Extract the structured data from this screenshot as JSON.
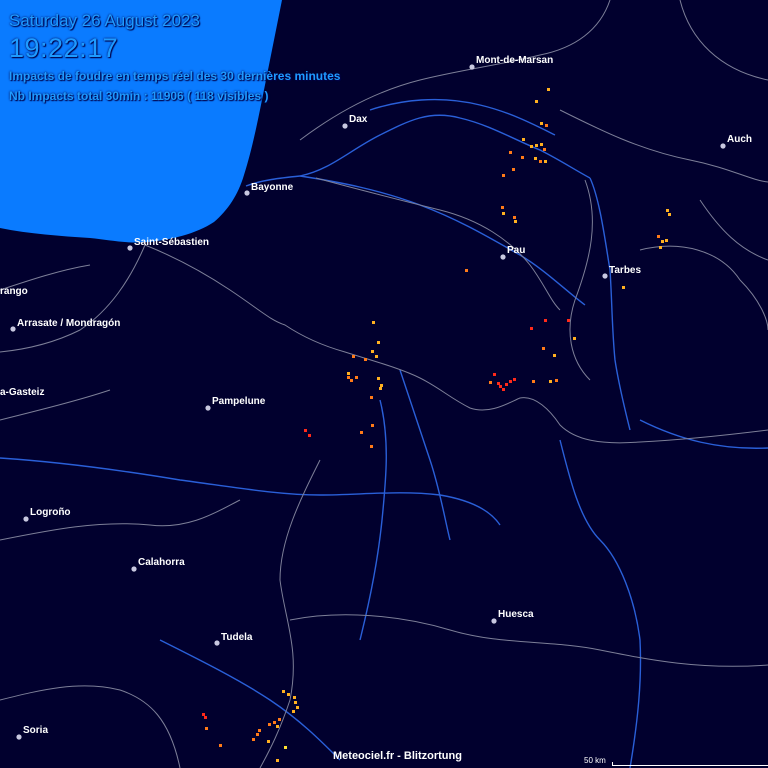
{
  "header": {
    "date": "Saturday 26 August 2023",
    "time": "19:22:17",
    "subtitle": "Impacts de foudre en temps réel des 30 dernières minutes",
    "count": "Nb Impacts total 30min : 11906 ( 118 visibles )"
  },
  "footer": {
    "credit": "Meteociel.fr - Blitzortung",
    "scale": "50 km"
  },
  "colors": {
    "background": "#01002e",
    "sea": "#0a7bff",
    "rivers": "#2a5fd8",
    "borders": "#7d7f98",
    "header_text": "#1e9bff",
    "city_label": "#ffffff",
    "city_dot": "#c8c8e0",
    "strike_recent": "#ff2a1a",
    "strike_mid": "#ff7a18",
    "strike_old": "#ffb020"
  },
  "cities": [
    {
      "name": "Mont-de-Marsan"
    },
    {
      "name": "Dax"
    },
    {
      "name": "Auch"
    },
    {
      "name": "Bayonne"
    },
    {
      "name": "Saint-Sébastien"
    },
    {
      "name": "Pau"
    },
    {
      "name": "Tarbes"
    },
    {
      "name": "rango"
    },
    {
      "name": "Arrasate / Mondragón"
    },
    {
      "name": "a-Gasteiz"
    },
    {
      "name": "Pampelune"
    },
    {
      "name": "Logroño"
    },
    {
      "name": "Calahorra"
    },
    {
      "name": "Huesca"
    },
    {
      "name": "Tudela"
    },
    {
      "name": "Soria"
    }
  ]
}
